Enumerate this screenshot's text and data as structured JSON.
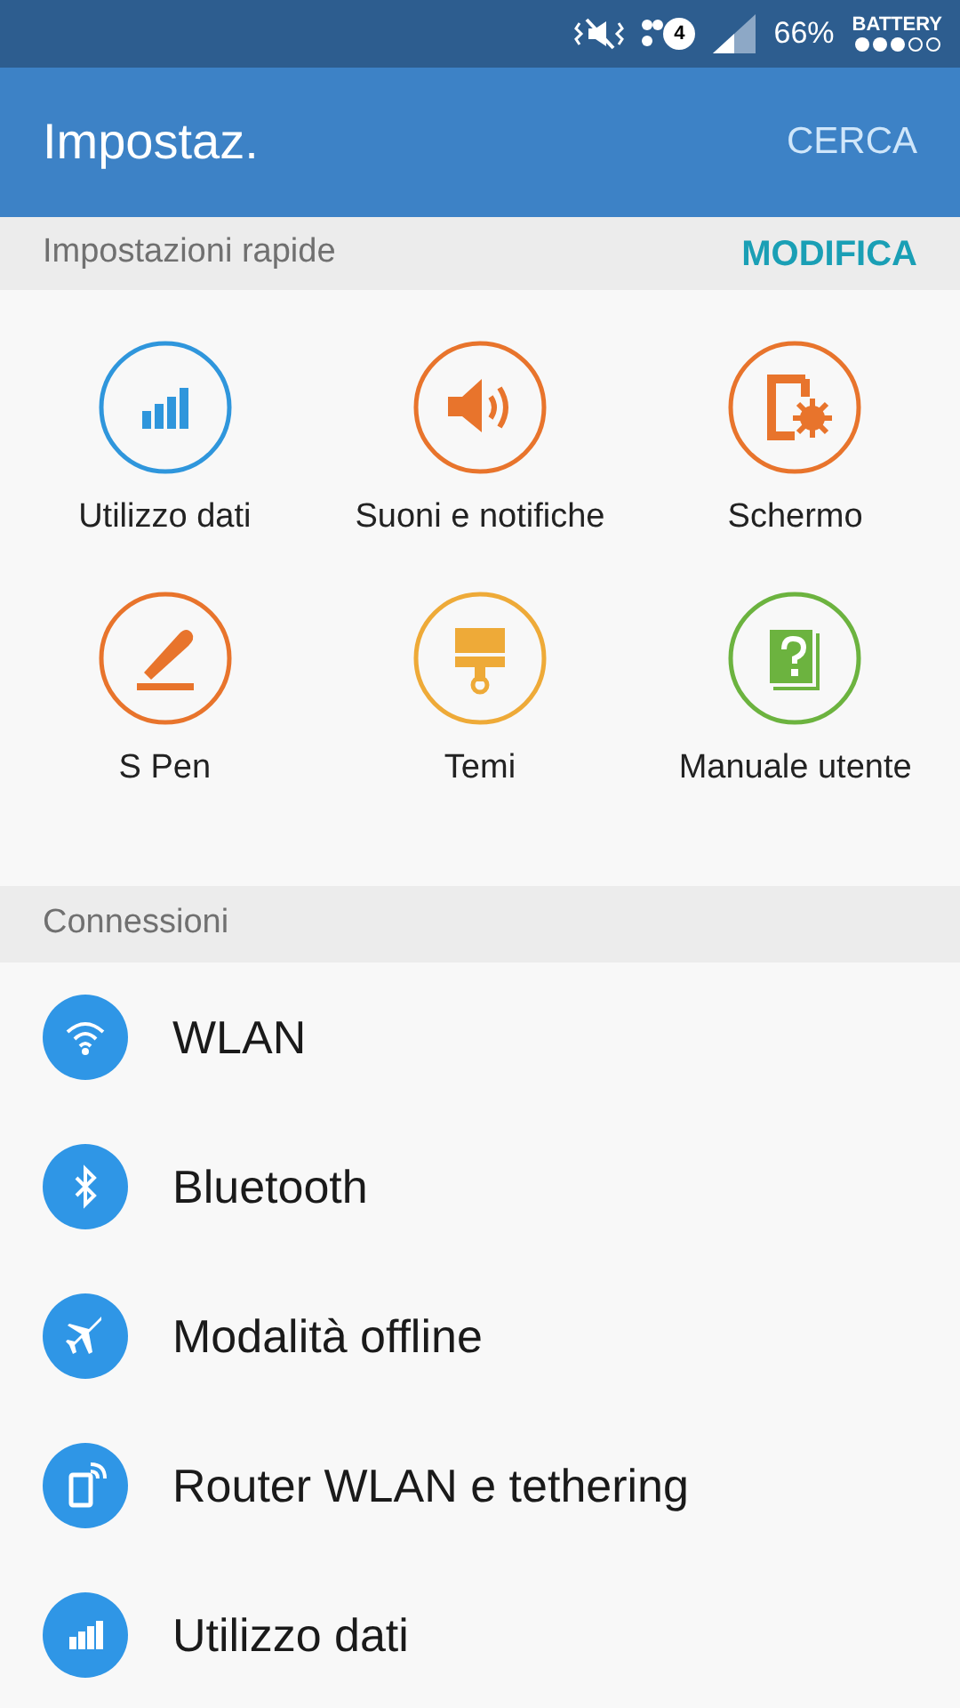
{
  "status_bar": {
    "notification_count": "4",
    "battery_percent": "66%",
    "battery_label": "BATTERY"
  },
  "app_bar": {
    "title": "Impostaz.",
    "action": "CERCA"
  },
  "quick_settings": {
    "title": "Impostazioni rapide",
    "action": "MODIFICA",
    "items": [
      {
        "label": "Utilizzo dati",
        "kind": "data",
        "color": "#2f96dc"
      },
      {
        "label": "Suoni e notifiche",
        "kind": "sound",
        "color": "#e8742c"
      },
      {
        "label": "Schermo",
        "kind": "display",
        "color": "#e8742c"
      },
      {
        "label": "S Pen",
        "kind": "pen",
        "color": "#e8742c"
      },
      {
        "label": "Temi",
        "kind": "theme",
        "color": "#eeaa38"
      },
      {
        "label": "Manuale utente",
        "kind": "manual",
        "color": "#6cb33f"
      }
    ]
  },
  "connections": {
    "title": "Connessioni",
    "items": [
      {
        "label": "WLAN",
        "kind": "wifi"
      },
      {
        "label": "Bluetooth",
        "kind": "bluetooth"
      },
      {
        "label": "Modalità offline",
        "kind": "airplane"
      },
      {
        "label": "Router WLAN e tethering",
        "kind": "hotspot"
      },
      {
        "label": "Utilizzo dati",
        "kind": "data"
      }
    ]
  }
}
